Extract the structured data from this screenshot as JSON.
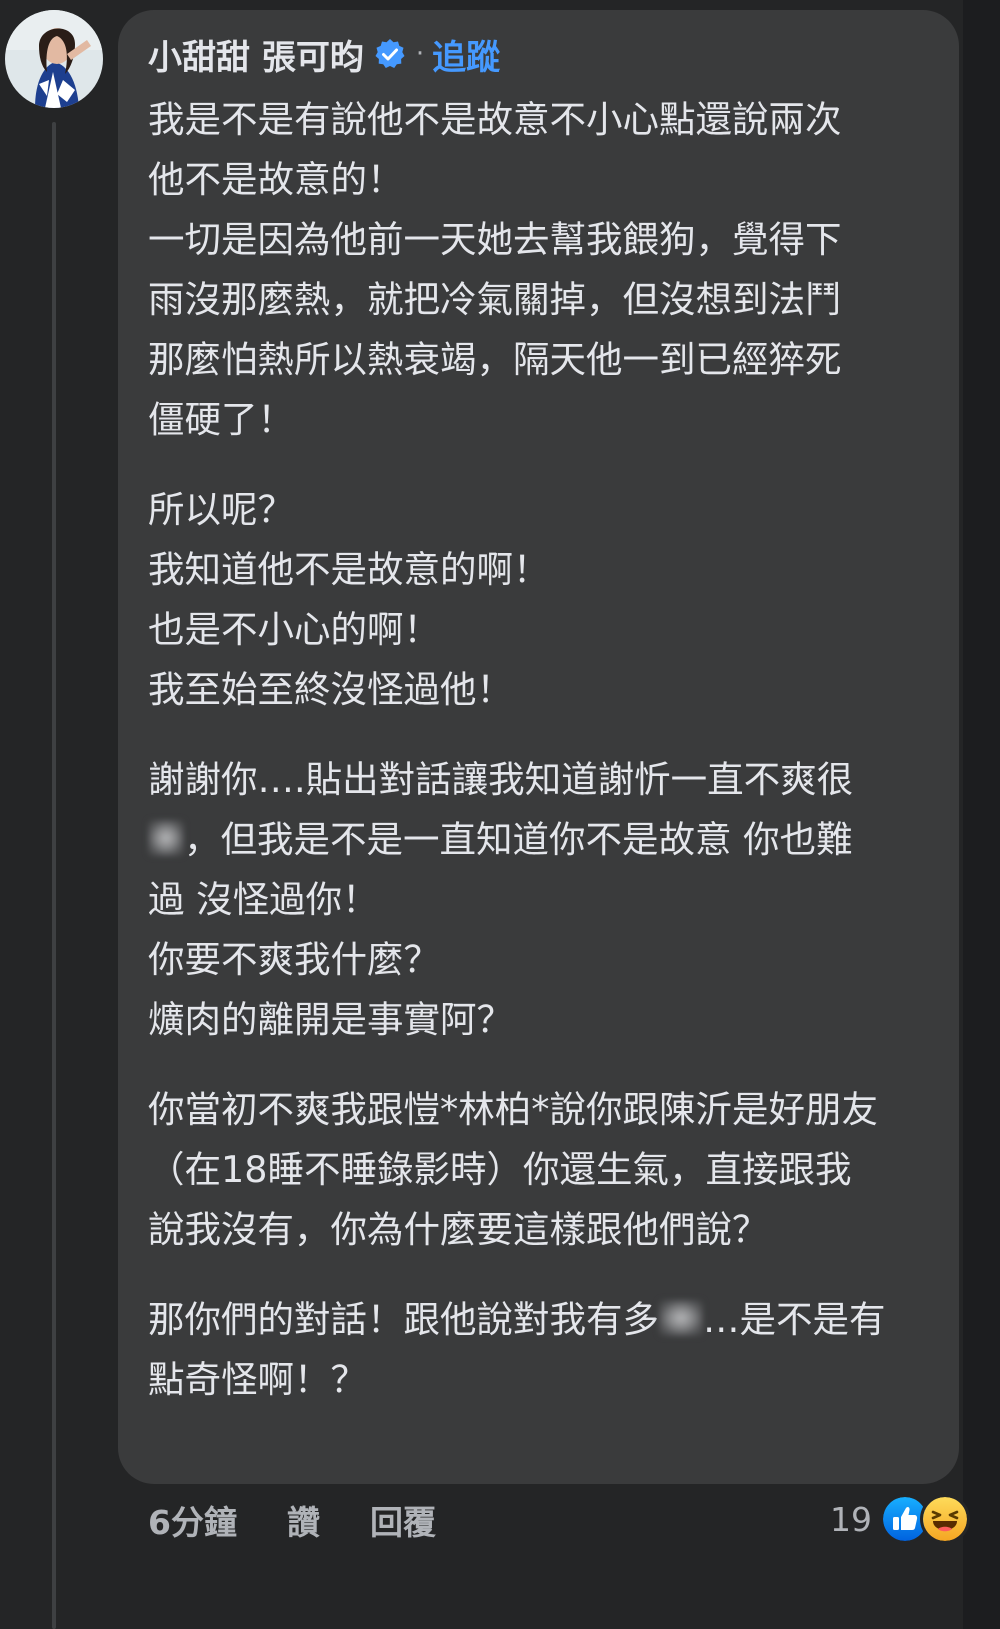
{
  "comment": {
    "author": "小甜甜 張可昀",
    "separator": "·",
    "follow_label": "追蹤",
    "body": {
      "p1": [
        "我是不是有說他不是故意不小心點還說兩次",
        "他不是故意的！",
        "一切是因為他前一天她去幫我餵狗，覺得下",
        "雨沒那麼熱，就把冷氣關掉，但沒想到法鬥",
        "那麼怕熱所以熱衰竭，隔天他一到已經猝死",
        "僵硬了！"
      ],
      "p2": [
        "所以呢？",
        "我知道他不是故意的啊！",
        "也是不小心的啊！",
        "我至始至終沒怪過他！"
      ],
      "p3": {
        "l1": "謝謝你….貼出對話讓我知道謝忻一直不爽很",
        "l2": "，但我是不是一直知道你不是故意 你也難",
        "l3": "過 沒怪過你！",
        "l4": "你要不爽我什麼？",
        "l5": "爌肉的離開是事實阿？"
      },
      "p4": [
        "你當初不爽我跟愷*林柏*說你跟陳沂是好朋友",
        "（在18睡不睡錄影時）你還生氣，直接跟我",
        "說我沒有，你為什麼要這樣跟他們說？"
      ],
      "p5": {
        "l1a": "那你們的對話！跟他說對我有多",
        "l1b": "…是不是有",
        "l2": "點奇怪啊！？"
      }
    },
    "time": "6分鐘",
    "like_label": "讚",
    "reply_label": "回覆",
    "reaction_count": "19",
    "reactions": [
      "like-icon",
      "haha-icon"
    ],
    "colors": {
      "background": "#242526",
      "bubble": "#3a3b3c",
      "text": "#e4e6eb",
      "secondary": "#b0b3b8",
      "link": "#4599ff"
    }
  }
}
